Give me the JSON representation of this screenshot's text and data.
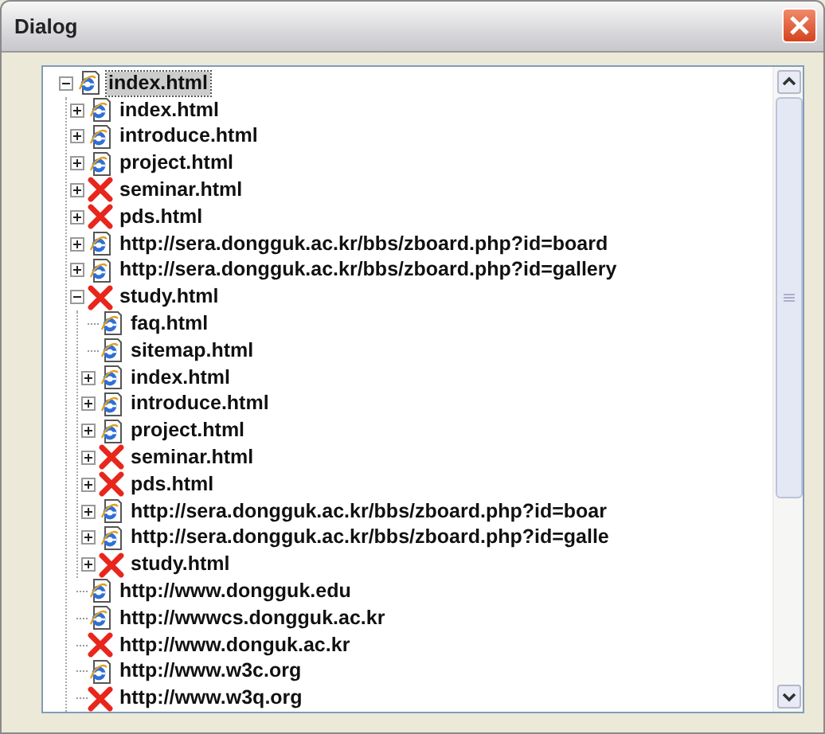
{
  "window": {
    "title": "Dialog"
  },
  "tree": {
    "nodes": [
      {
        "label": "index.html",
        "broken": false,
        "selected": true,
        "expandable": true,
        "expanded": true,
        "children": [
          {
            "label": "index.html",
            "broken": false,
            "selected": false,
            "expandable": true,
            "expanded": false
          },
          {
            "label": "introduce.html",
            "broken": false,
            "selected": false,
            "expandable": true,
            "expanded": false
          },
          {
            "label": "project.html",
            "broken": false,
            "selected": false,
            "expandable": true,
            "expanded": false
          },
          {
            "label": "seminar.html",
            "broken": true,
            "selected": false,
            "expandable": true,
            "expanded": false
          },
          {
            "label": "pds.html",
            "broken": true,
            "selected": false,
            "expandable": true,
            "expanded": false
          },
          {
            "label": "http://sera.dongguk.ac.kr/bbs/zboard.php?id=board",
            "broken": false,
            "selected": false,
            "expandable": true,
            "expanded": false
          },
          {
            "label": "http://sera.dongguk.ac.kr/bbs/zboard.php?id=gallery",
            "broken": false,
            "selected": false,
            "expandable": true,
            "expanded": false
          },
          {
            "label": "study.html",
            "broken": true,
            "selected": false,
            "expandable": true,
            "expanded": true,
            "children": [
              {
                "label": "faq.html",
                "broken": false,
                "selected": false,
                "expandable": false
              },
              {
                "label": "sitemap.html",
                "broken": false,
                "selected": false,
                "expandable": false
              },
              {
                "label": "index.html",
                "broken": false,
                "selected": false,
                "expandable": true,
                "expanded": false
              },
              {
                "label": "introduce.html",
                "broken": false,
                "selected": false,
                "expandable": true,
                "expanded": false
              },
              {
                "label": "project.html",
                "broken": false,
                "selected": false,
                "expandable": true,
                "expanded": false
              },
              {
                "label": "seminar.html",
                "broken": true,
                "selected": false,
                "expandable": true,
                "expanded": false
              },
              {
                "label": "pds.html",
                "broken": true,
                "selected": false,
                "expandable": true,
                "expanded": false
              },
              {
                "label": "http://sera.dongguk.ac.kr/bbs/zboard.php?id=boar",
                "broken": false,
                "selected": false,
                "expandable": true,
                "expanded": false
              },
              {
                "label": "http://sera.dongguk.ac.kr/bbs/zboard.php?id=galle",
                "broken": false,
                "selected": false,
                "expandable": true,
                "expanded": false
              },
              {
                "label": "study.html",
                "broken": true,
                "selected": false,
                "expandable": true,
                "expanded": false
              }
            ]
          },
          {
            "label": "http://www.dongguk.edu",
            "broken": false,
            "selected": false,
            "expandable": false
          },
          {
            "label": "http://wwwcs.dongguk.ac.kr",
            "broken": false,
            "selected": false,
            "expandable": false
          },
          {
            "label": "http://www.donguk.ac.kr",
            "broken": true,
            "selected": false,
            "expandable": false
          },
          {
            "label": "http://www.w3c.org",
            "broken": false,
            "selected": false,
            "expandable": false
          },
          {
            "label": "http://www.w3q.org",
            "broken": true,
            "selected": false,
            "expandable": false
          }
        ]
      }
    ]
  }
}
